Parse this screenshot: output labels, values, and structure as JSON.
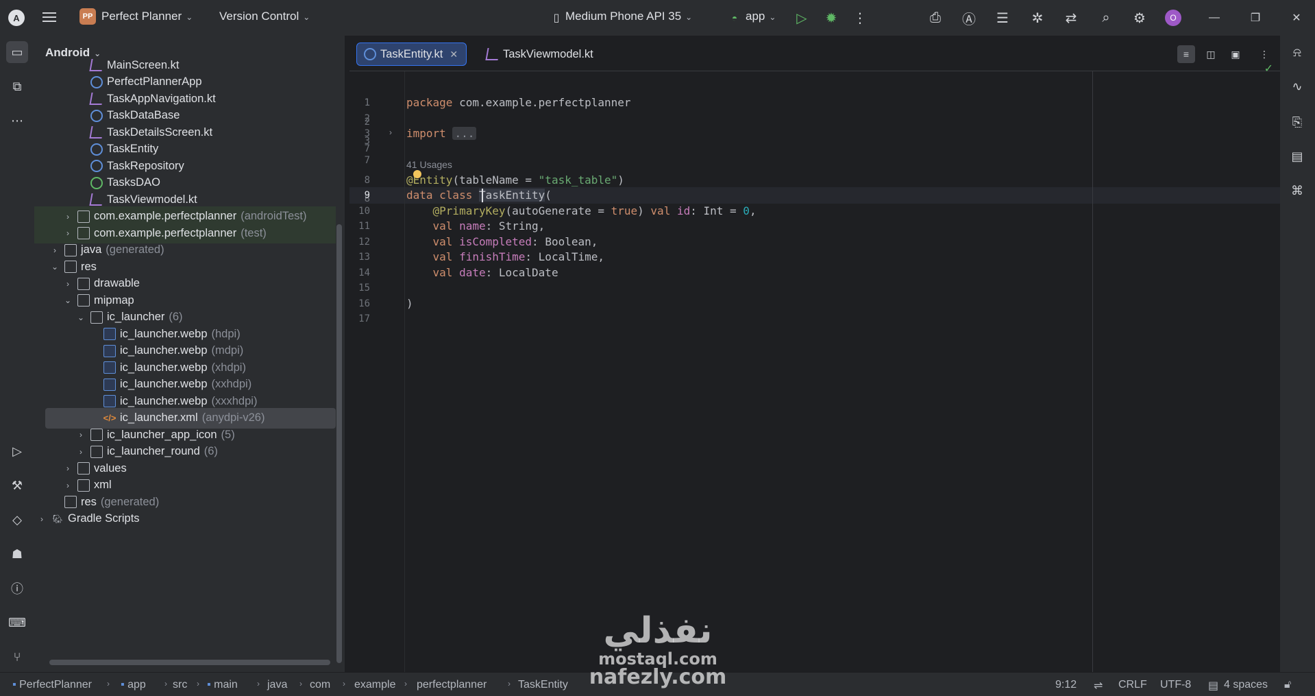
{
  "titlebar": {
    "project_badge": "PP",
    "project_name": "Perfect Planner",
    "vcs": "Version Control",
    "device": "Medium Phone API 35",
    "run_config": "app",
    "avatar": "O"
  },
  "project_panel": {
    "view_mode": "Android",
    "items": [
      {
        "label": "MainScreen.kt",
        "suffix": "",
        "icon": "kotlin-file-icon"
      },
      {
        "label": "PerfectPlannerApp",
        "suffix": "",
        "icon": "class-icon"
      },
      {
        "label": "TaskAppNavigation.kt",
        "suffix": "",
        "icon": "kotlin-file-icon"
      },
      {
        "label": "TaskDataBase",
        "suffix": "",
        "icon": "class-icon"
      },
      {
        "label": "TaskDetailsScreen.kt",
        "suffix": "",
        "icon": "kotlin-file-icon"
      },
      {
        "label": "TaskEntity",
        "suffix": "",
        "icon": "class-icon"
      },
      {
        "label": "TaskRepository",
        "suffix": "",
        "icon": "class-icon"
      },
      {
        "label": "TasksDAO",
        "suffix": "",
        "icon": "interface-icon"
      },
      {
        "label": "TaskViewmodel.kt",
        "suffix": "",
        "icon": "kotlin-file-icon"
      },
      {
        "label": "com.example.perfectplanner",
        "suffix": "(androidTest)",
        "icon": "package-icon"
      },
      {
        "label": "com.example.perfectplanner",
        "suffix": "(test)",
        "icon": "package-icon"
      },
      {
        "label": "java",
        "suffix": "(generated)",
        "icon": "folder-icon"
      },
      {
        "label": "res",
        "suffix": "",
        "icon": "folder-icon"
      },
      {
        "label": "drawable",
        "suffix": "",
        "icon": "folder-icon"
      },
      {
        "label": "mipmap",
        "suffix": "",
        "icon": "folder-icon"
      },
      {
        "label": "ic_launcher",
        "suffix": "(6)",
        "icon": "folder-icon"
      },
      {
        "label": "ic_launcher.webp",
        "suffix": "(hdpi)",
        "icon": "image-file-icon"
      },
      {
        "label": "ic_launcher.webp",
        "suffix": "(mdpi)",
        "icon": "image-file-icon"
      },
      {
        "label": "ic_launcher.webp",
        "suffix": "(xhdpi)",
        "icon": "image-file-icon"
      },
      {
        "label": "ic_launcher.webp",
        "suffix": "(xxhdpi)",
        "icon": "image-file-icon"
      },
      {
        "label": "ic_launcher.webp",
        "suffix": "(xxxhdpi)",
        "icon": "image-file-icon"
      },
      {
        "label": "ic_launcher.xml",
        "suffix": "(anydpi-v26)",
        "icon": "xml-file-icon"
      },
      {
        "label": "ic_launcher_app_icon",
        "suffix": "(5)",
        "icon": "folder-icon"
      },
      {
        "label": "ic_launcher_round",
        "suffix": "(6)",
        "icon": "folder-icon"
      },
      {
        "label": "values",
        "suffix": "",
        "icon": "folder-icon"
      },
      {
        "label": "xml",
        "suffix": "",
        "icon": "folder-icon"
      },
      {
        "label": "res",
        "suffix": "(generated)",
        "icon": "folder-icon"
      },
      {
        "label": "Gradle Scripts",
        "suffix": "",
        "icon": "gradle-icon"
      }
    ]
  },
  "editor": {
    "tabs": [
      {
        "label": "TaskEntity.kt",
        "active": true
      },
      {
        "label": "TaskViewmodel.kt",
        "active": false
      }
    ],
    "line_numbers": [
      "1",
      "2",
      "3",
      "7",
      "8",
      "9",
      "10",
      "11",
      "12",
      "13",
      "14",
      "15",
      "16",
      "17"
    ],
    "usages_hint": "41 Usages",
    "code": {
      "l1_kw": "package",
      "l1_rest": " com.example.perfectplanner",
      "l3_kw": "import",
      "l3_fold": "...",
      "l8_ann": "@Entity",
      "l8_open": "(tableName = ",
      "l8_str": "\"task_table\"",
      "l8_close": ")",
      "l9_kw": "data class",
      "l9_name": "TaskEntity",
      "l9_paren": "(",
      "l10_ann": "@PrimaryKey",
      "l10_a": "(autoGenerate = ",
      "l10_true": "true",
      "l10_b": ") ",
      "l10_val": "val",
      "l10_prop": "id",
      "l10_type": ": Int = ",
      "l10_num": "0",
      "l10_end": ",",
      "l11_val": "val",
      "l11_prop": "name",
      "l11_type": ": String,",
      "l12_val": "val",
      "l12_prop": "isCompleted",
      "l12_type": ": Boolean,",
      "l13_val": "val",
      "l13_prop": "finishTime",
      "l13_type": ": LocalTime,",
      "l14_val": "val",
      "l14_prop": "date",
      "l14_type": ": LocalDate",
      "l16": ")"
    }
  },
  "statusbar": {
    "breadcrumbs": [
      "PerfectPlanner",
      "app",
      "src",
      "main",
      "java",
      "com",
      "example",
      "perfectplanner",
      "TaskEntity"
    ],
    "cursor": "9:12",
    "line_ending": "CRLF",
    "encoding": "UTF-8",
    "indent": "4 spaces"
  },
  "watermark": {
    "arabic": "نفذلي",
    "line1": "mostaql.com",
    "line2": "nafezly.com"
  }
}
